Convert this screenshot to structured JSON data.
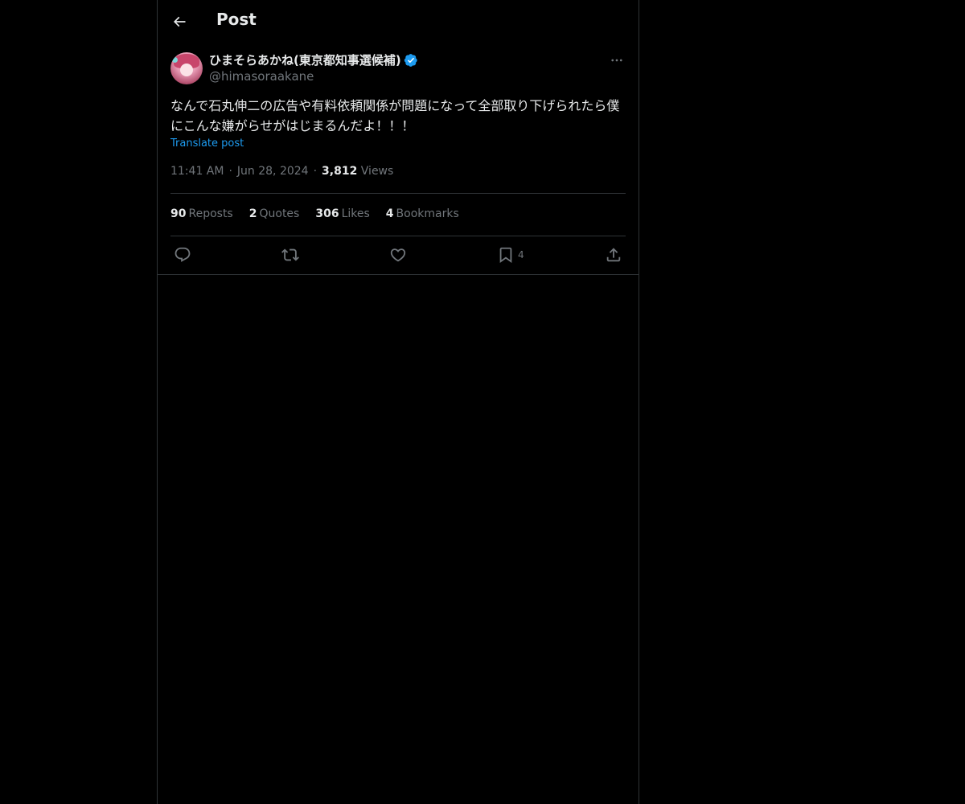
{
  "header": {
    "title": "Post"
  },
  "author": {
    "display_name": "ひまそらあかね(東京都知事選候補)",
    "handle": "@himasoraakane",
    "verified_color": "#1d9bf0"
  },
  "post": {
    "text": "なんで石丸伸二の広告や有料依頼関係が問題になって全部取り下げられたら僕にこんな嫌がらせがはじまるんだよ！！！",
    "translate_label": "Translate post",
    "time": "11:41 AM",
    "date": "Jun 28, 2024",
    "views_count": "3,812",
    "views_label": "Views"
  },
  "stats": [
    {
      "count": "90",
      "label": "Reposts"
    },
    {
      "count": "2",
      "label": "Quotes"
    },
    {
      "count": "306",
      "label": "Likes"
    },
    {
      "count": "4",
      "label": "Bookmarks"
    }
  ],
  "actions": {
    "bookmark_count": "4"
  },
  "colors": {
    "background": "#000000",
    "text": "#e7e9ea",
    "muted": "#71767b",
    "border": "#2f3336",
    "link": "#1d9bf0"
  }
}
